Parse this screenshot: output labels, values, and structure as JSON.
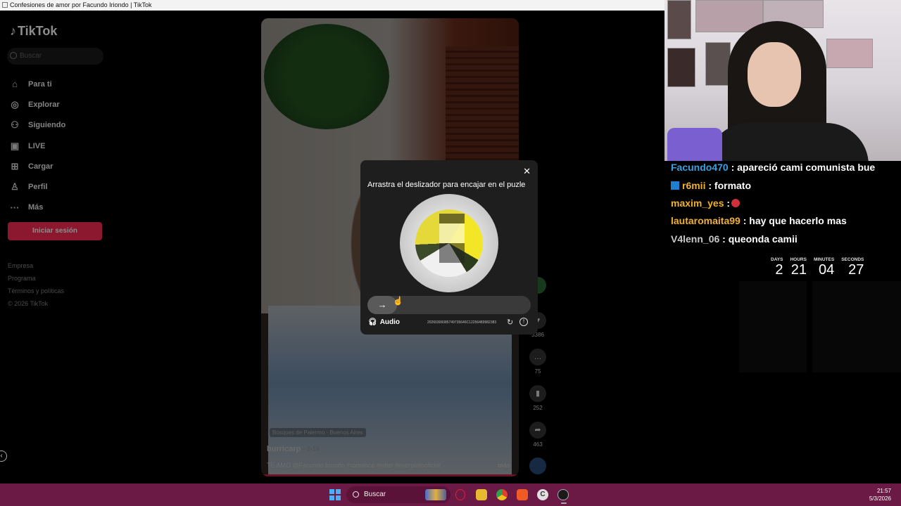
{
  "window": {
    "title": "Confesiones de amor por Facundo Iriondo | TikTok"
  },
  "sidebar": {
    "logo": "TikTok",
    "search_placeholder": "Buscar",
    "items": [
      {
        "label": "Para ti",
        "icon": "home-icon"
      },
      {
        "label": "Explorar",
        "icon": "compass-icon"
      },
      {
        "label": "Siguiendo",
        "icon": "following-icon"
      },
      {
        "label": "LIVE",
        "icon": "live-icon"
      },
      {
        "label": "Cargar",
        "icon": "upload-icon"
      },
      {
        "label": "Perfil",
        "icon": "profile-icon"
      },
      {
        "label": "Más",
        "icon": "more-icon"
      }
    ],
    "login_label": "Iniciar sesión",
    "footer": [
      "Empresa",
      "Programa",
      "Términos y políticas",
      "© 2026 TikTok"
    ]
  },
  "video": {
    "location": "Bosques de Palermo · Buenos Aires",
    "author": "burricarp",
    "date": "· 2-15",
    "description": "TE AMO @Facundo Iriondo #romance #infiel #riverplatooficial",
    "more": "más"
  },
  "actions": {
    "likes": "3386",
    "comments": "75",
    "saves": "252",
    "shares": "463"
  },
  "captcha": {
    "title": "Arrastra el deslizador para encajar en el puzle",
    "audio_label": "Audio",
    "hash": "20260306085749735646C12256489982383",
    "close_glyph": "✕",
    "slider_glyph": "→"
  },
  "chat": [
    {
      "user": "Facundo470",
      "text": " : apareció cami comunista bue",
      "color": "blue"
    },
    {
      "user": "r6mii",
      "text": " : formato",
      "color": "orange",
      "badge": true
    },
    {
      "user": "maxim_yes",
      "text": " :",
      "color": "orange",
      "emote": true
    },
    {
      "user": "lautaromaita99",
      "text": " : hay que hacerlo mas",
      "color": "orange"
    },
    {
      "user": "V4lenn_06",
      "text": " : queonda camii",
      "color": "grey"
    }
  ],
  "countdown": {
    "days_label": "DAYS",
    "days": "2",
    "hours_label": "HOURS",
    "hours": "21",
    "minutes_label": "MINUTES",
    "minutes": "04",
    "seconds_label": "SECONDS",
    "seconds": "27"
  },
  "taskbar": {
    "search_label": "Buscar",
    "time": "21:57",
    "date": "5/3/2026"
  }
}
